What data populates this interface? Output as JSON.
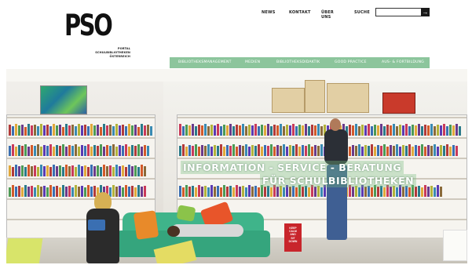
{
  "logo": {
    "text": "PSO",
    "subtitle_lines": [
      "PORTAL",
      "SCHULBIBLIOTHEKEN",
      "ÖSTERREICH"
    ]
  },
  "topnav": {
    "news": "NEWS",
    "kontakt": "KONTAKT",
    "ueber_uns": "ÜBER UNS",
    "suche": "SUCHE"
  },
  "search": {
    "value": "",
    "button_icon": "arrow-right-icon",
    "button_glyph": "→"
  },
  "mainnav": {
    "items": [
      "BIBLIOTHEKSMANAGEMENT",
      "MEDIEN",
      "BIBLIOTHEKSDIDAKTIK",
      "GOOD PRACTICE",
      "AUS- & FORTBILDUNG"
    ]
  },
  "hero": {
    "title_line1": "INFORMATION - SERVICE - BERATUNG",
    "title_line2": "FÜR SCHULBIBLIOTHEKEN",
    "poster_text": [
      "KEEP",
      "CALM",
      "AND",
      "SIT",
      "DOWN"
    ]
  },
  "colors": {
    "nav_green": "#8cc59c",
    "sofa_green": "#3fb48a",
    "poster_red": "#c8252b"
  }
}
